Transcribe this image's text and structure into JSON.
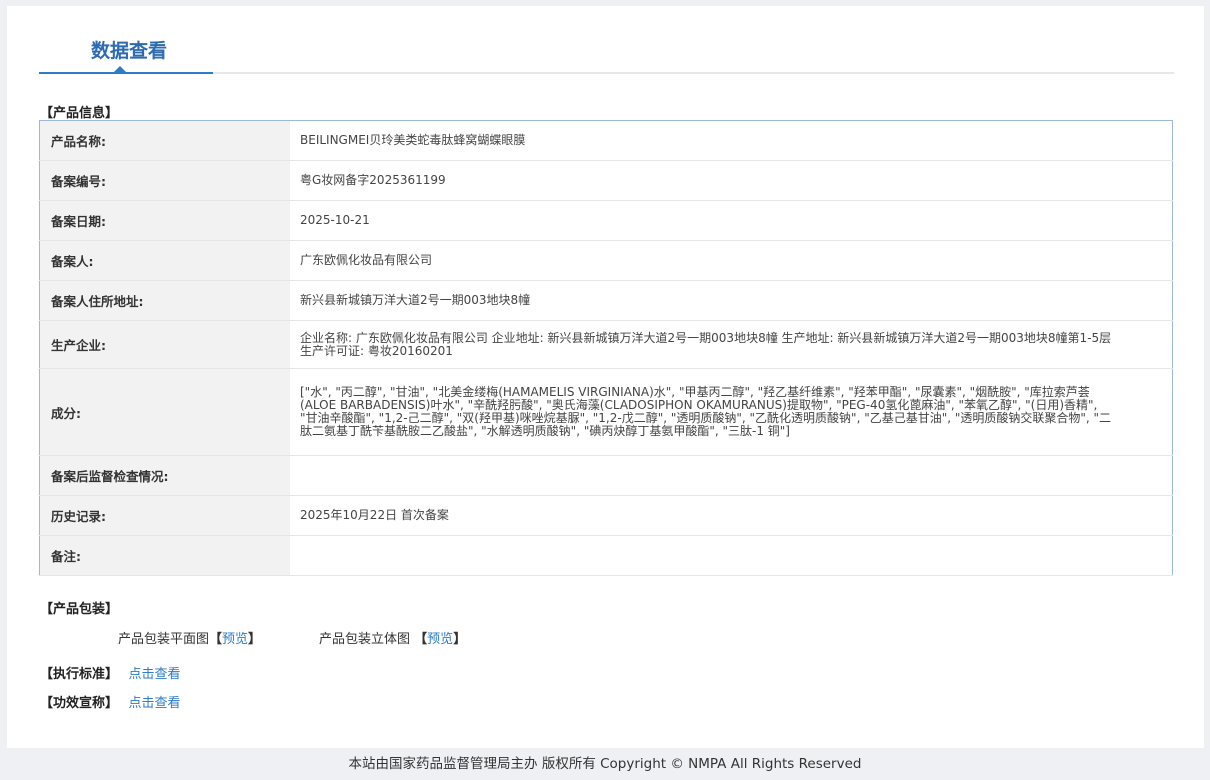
{
  "tab": {
    "title": "数据查看"
  },
  "product_info": {
    "label": "【产品信息】",
    "rows": [
      {
        "key": "产品名称:",
        "value": "BEILINGMEI贝玲美类蛇毒肽蜂窝蝴蝶眼膜"
      },
      {
        "key": "备案编号:",
        "value": "粤G妆网备字2025361199"
      },
      {
        "key": "备案日期:",
        "value": "2025-10-21"
      },
      {
        "key": "备案人:",
        "value": "广东欧佩化妆品有限公司"
      },
      {
        "key": "备案人住所地址:",
        "value": "新兴县新城镇万洋大道2号一期003地块8幢"
      },
      {
        "key": "生产企业:",
        "value": "企业名称: 广东欧佩化妆品有限公司 企业地址: 新兴县新城镇万洋大道2号一期003地块8幢 生产地址: 新兴县新城镇万洋大道2号一期003地块8幢第1-5层 生产许可证: 粤妆20160201"
      },
      {
        "key": "成分:",
        "value": "[\"水\", \"丙二醇\", \"甘油\", \"北美金缕梅(HAMAMELIS VIRGINIANA)水\", \"甲基丙二醇\", \"羟乙基纤维素\", \"羟苯甲酯\", \"尿囊素\", \"烟酰胺\", \"库拉索芦荟(ALOE BARBADENSIS)叶水\", \"辛酰羟肟酸\", \"奥氏海藻(CLADOSIPHON OKAMURANUS)提取物\", \"PEG-40氢化蓖麻油\", \"苯氧乙醇\", \"(日用)香精\", \"甘油辛酸酯\", \"1,2-己二醇\", \"双(羟甲基)咪唑烷基脲\", \"1,2-戊二醇\", \"透明质酸钠\", \"乙酰化透明质酸钠\", \"乙基己基甘油\", \"透明质酸钠交联聚合物\", \"二肽二氨基丁酰苄基酰胺二乙酸盐\", \"水解透明质酸钠\", \"碘丙炔醇丁基氨甲酸酯\", \"三肽-1 铜\"]"
      },
      {
        "key": "备案后监督检查情况:",
        "value": ""
      },
      {
        "key": "历史记录:",
        "value": "2025年10月22日 首次备案"
      },
      {
        "key": "备注:",
        "value": ""
      }
    ]
  },
  "packaging": {
    "label": "【产品包装】",
    "flat_label": "产品包装平面图",
    "solid_label": "产品包装立体图",
    "bracket_open": "【",
    "bracket_close": "】",
    "preview": "预览"
  },
  "standard": {
    "label": "【执行标准】",
    "link": "点击查看"
  },
  "efficacy": {
    "label": "【功效宣称】",
    "link": "点击查看"
  },
  "footer": {
    "text": "本站由国家药品监督管理局主办 版权所有 Copyright © NMPA All Rights Reserved"
  }
}
